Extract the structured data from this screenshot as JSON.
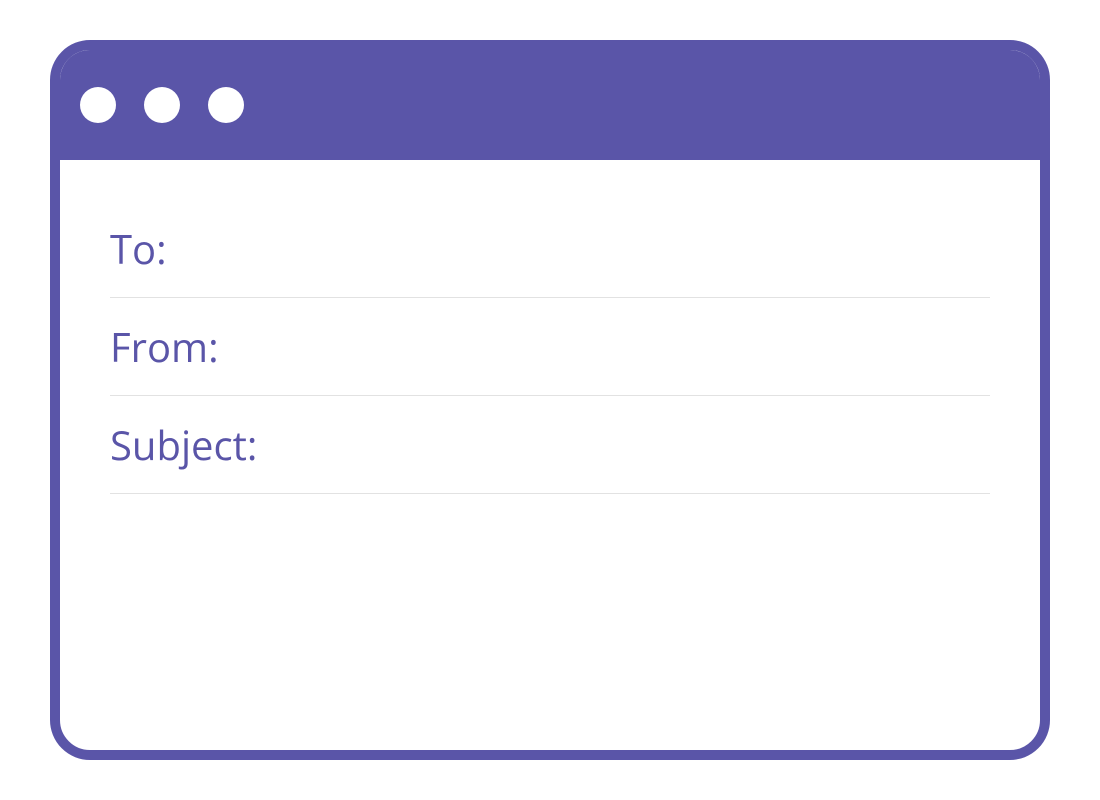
{
  "colors": {
    "accent": "#5A55A8",
    "divider": "#e2e2e2",
    "background": "#ffffff"
  },
  "compose": {
    "fields": {
      "to_label": "To:",
      "to_value": "",
      "from_label": "From:",
      "from_value": "",
      "subject_label": "Subject:",
      "subject_value": ""
    },
    "body_value": ""
  }
}
